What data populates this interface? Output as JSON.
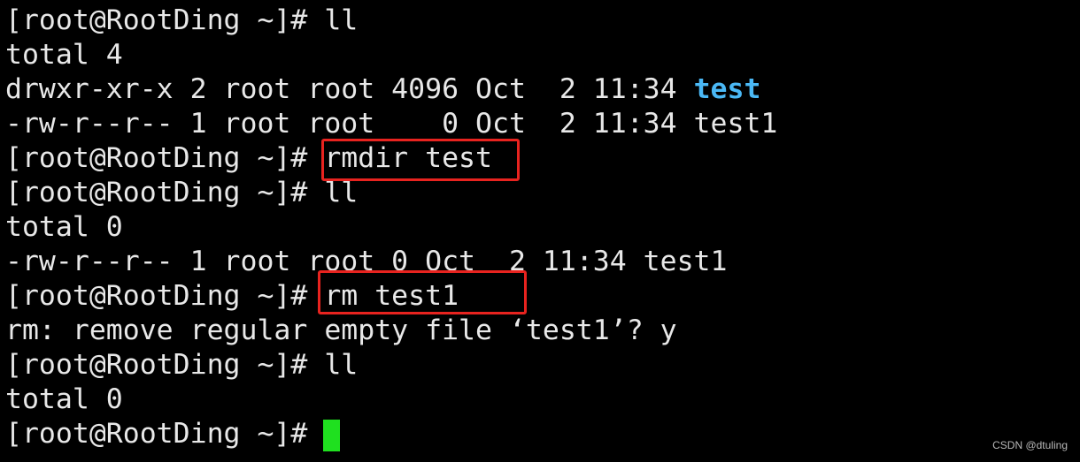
{
  "terminal": {
    "lines": [
      "[root@RootDing ~]# ll",
      "total 4",
      "drwxr-xr-x 2 root root 4096 Oct  2 11:34 ",
      "-rw-r--r-- 1 root root    0 Oct  2 11:34 test1",
      "[root@RootDing ~]# rmdir test",
      "[root@RootDing ~]# ll",
      "total 0",
      "-rw-r--r-- 1 root root 0 Oct  2 11:34 test1",
      "[root@RootDing ~]# rm test1",
      "rm: remove regular empty file ‘test1’? y",
      "[root@RootDing ~]# ll",
      "total 0",
      "[root@RootDing ~]# "
    ],
    "dir_name": "test",
    "dir_color": "#4ab8f5",
    "highlight_color": "#e8231f",
    "cursor_color": "#1fe01f"
  },
  "watermark": "CSDN @dtuling"
}
